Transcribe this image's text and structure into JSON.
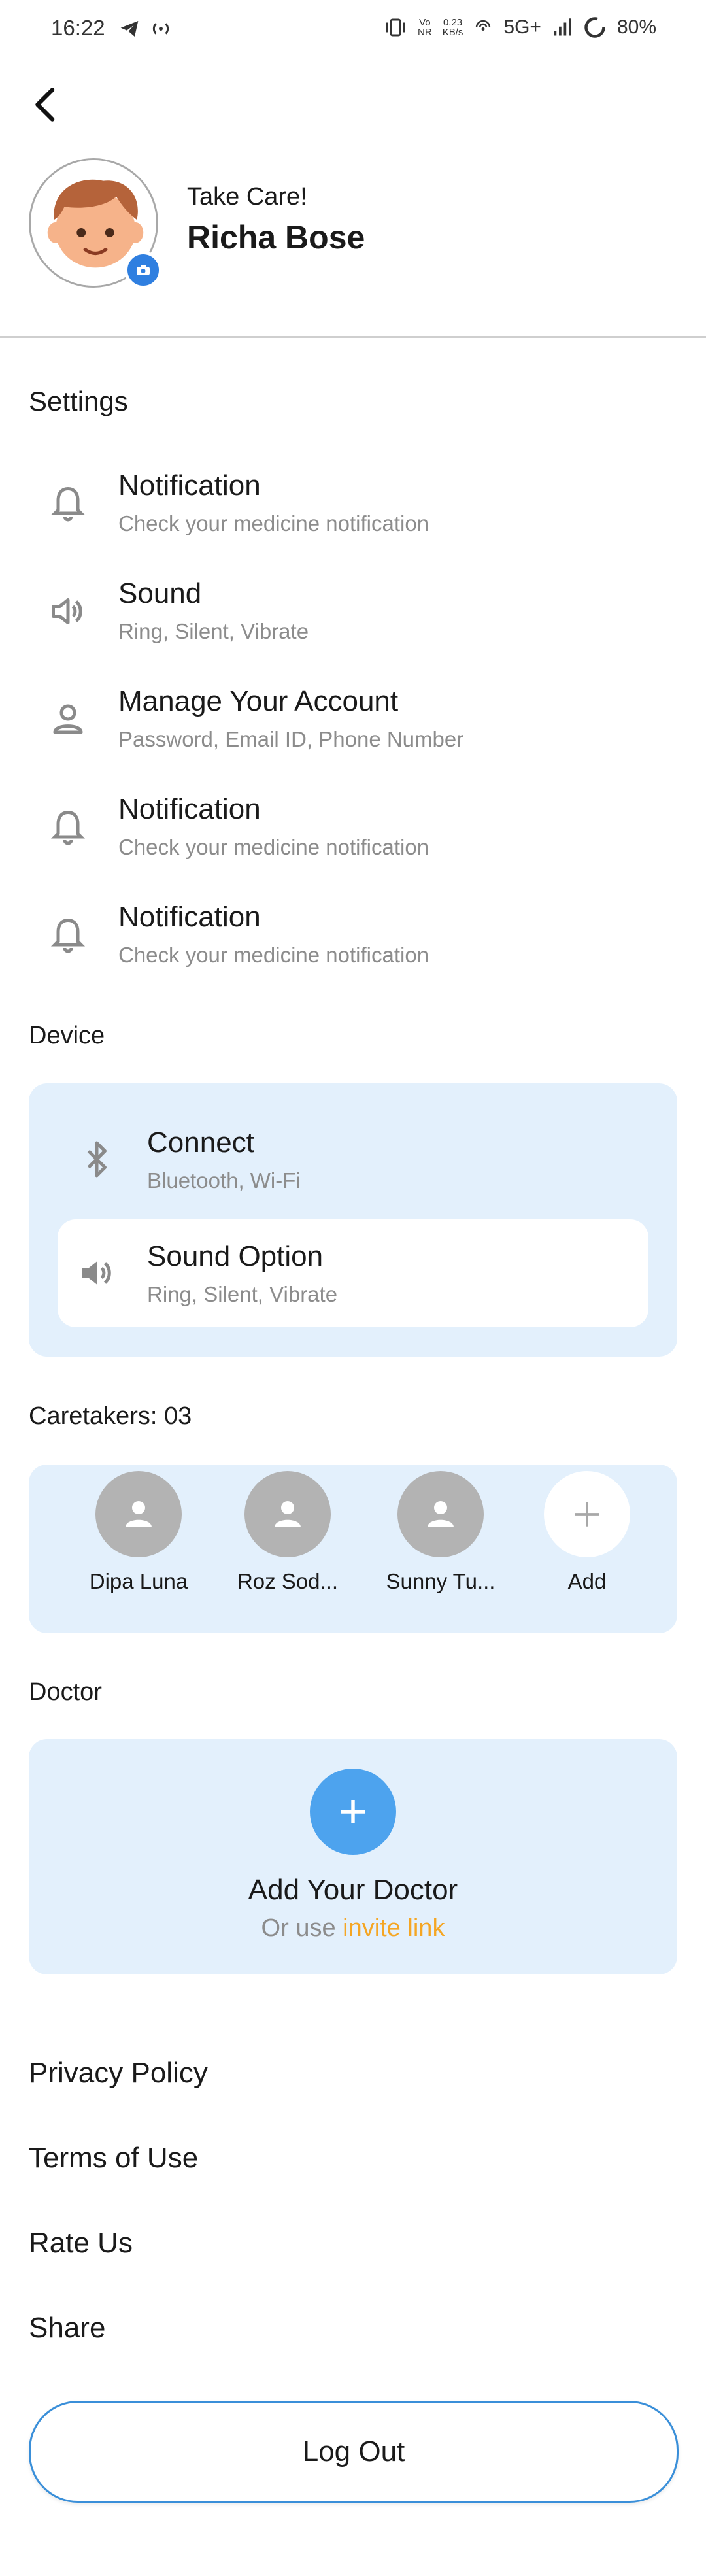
{
  "status_bar": {
    "time": "16:22",
    "net_speed_value": "0.23",
    "net_speed_unit": "KB/s",
    "vo_top": "Vo",
    "vo_bottom": "NR",
    "network": "5G+",
    "battery": "80%"
  },
  "profile": {
    "greeting": "Take Care!",
    "name": "Richa Bose"
  },
  "settings": {
    "title": "Settings",
    "items": [
      {
        "title": "Notification",
        "subtitle": "Check your medicine notification",
        "icon": "bell-icon"
      },
      {
        "title": "Sound",
        "subtitle": "Ring, Silent, Vibrate",
        "icon": "speaker-icon"
      },
      {
        "title": "Manage Your Account",
        "subtitle": "Password, Email ID, Phone Number",
        "icon": "person-icon"
      },
      {
        "title": "Notification",
        "subtitle": "Check your medicine notification",
        "icon": "bell-icon"
      },
      {
        "title": "Notification",
        "subtitle": "Check your medicine notification",
        "icon": "bell-icon"
      }
    ]
  },
  "device": {
    "title": "Device",
    "items": [
      {
        "title": "Connect",
        "subtitle": "Bluetooth, Wi-Fi",
        "icon": "bluetooth-icon"
      },
      {
        "title": "Sound Option",
        "subtitle": "Ring, Silent, Vibrate",
        "icon": "speaker-icon"
      }
    ]
  },
  "caretakers": {
    "title": "Caretakers: 03",
    "items": [
      {
        "name": "Dipa Luna"
      },
      {
        "name": "Roz Sod..."
      },
      {
        "name": "Sunny Tu..."
      }
    ],
    "add_label": "Add"
  },
  "doctor": {
    "title": "Doctor",
    "add_label": "Add Your Doctor",
    "or_use": "Or use",
    "invite_link": "invite link"
  },
  "links": {
    "privacy": "Privacy Policy",
    "terms": "Terms of Use",
    "rate": "Rate Us",
    "share": "Share"
  },
  "logout_label": "Log Out",
  "colors": {
    "accent_blue": "#4da3ee",
    "card_bg": "#e3f0fc",
    "link_orange": "#f5a623",
    "muted_text": "#8c8c8c"
  }
}
